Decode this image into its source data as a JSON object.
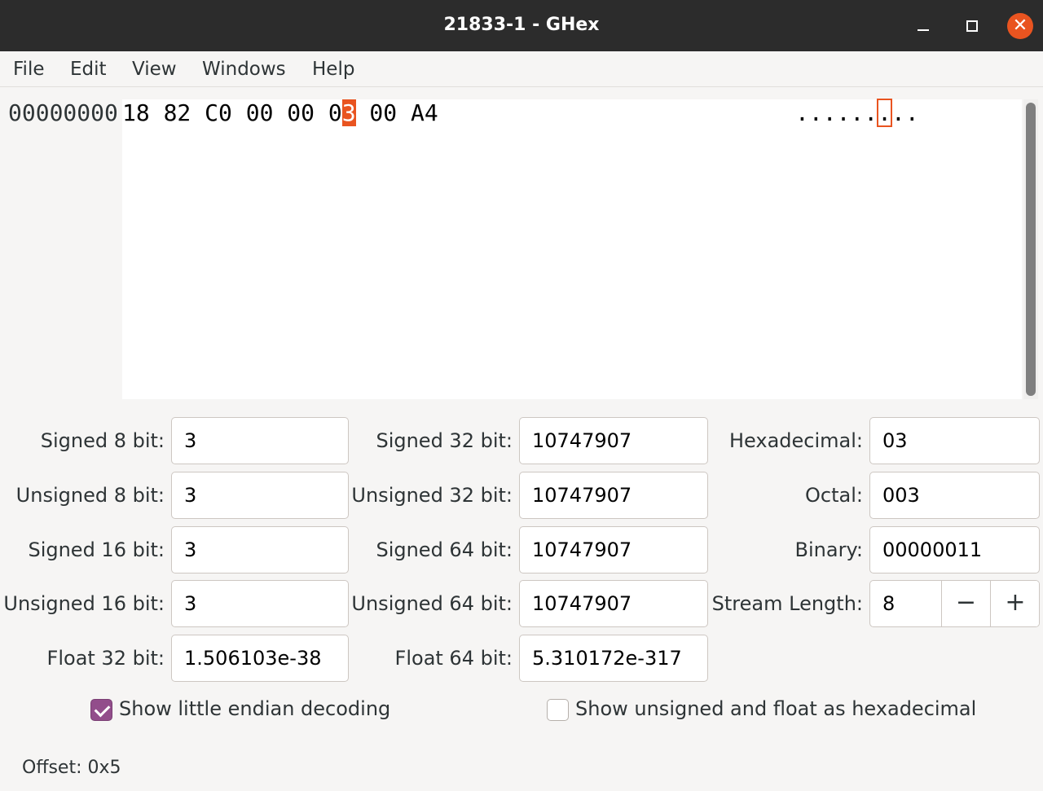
{
  "window": {
    "title": "21833-1 - GHex",
    "minimize_icon": "minimize-icon",
    "maximize_icon": "maximize-icon",
    "close_icon": "close-icon",
    "close_glyph": "✕",
    "accent": "#e95420"
  },
  "menu": {
    "items": [
      "File",
      "Edit",
      "View",
      "Windows",
      "Help"
    ]
  },
  "hex": {
    "offset": "00000000",
    "bytes_before_cursor": "18 82 C0 00 00 0",
    "cursor_nibble": "3",
    "bytes_after_cursor": " 00 A4",
    "ascii_before": "......",
    "ascii_cursor": ".",
    "ascii_after": ".."
  },
  "converter": {
    "signed8_label": "Signed 8 bit:",
    "signed8": "3",
    "unsigned8_label": "Unsigned 8 bit:",
    "unsigned8": "3",
    "signed16_label": "Signed 16 bit:",
    "signed16": "3",
    "unsigned16_label": "Unsigned 16 bit:",
    "unsigned16": "3",
    "float32_label": "Float 32 bit:",
    "float32": "1.506103e-38",
    "signed32_label": "Signed 32 bit:",
    "signed32": "10747907",
    "unsigned32_label": "Unsigned 32 bit:",
    "unsigned32": "10747907",
    "signed64_label": "Signed 64 bit:",
    "signed64": "10747907",
    "unsigned64_label": "Unsigned 64 bit:",
    "unsigned64": "10747907",
    "float64_label": "Float 64 bit:",
    "float64": "5.310172e-317",
    "hex_label": "Hexadecimal:",
    "hex": "03",
    "octal_label": "Octal:",
    "octal": "003",
    "binary_label": "Binary:",
    "binary": "00000011",
    "stream_label": "Stream Length:",
    "stream": "8",
    "stream_minus": "−",
    "stream_plus": "+"
  },
  "options": {
    "little_endian_label": "Show little endian decoding",
    "little_endian_checked": true,
    "hex_display_label": "Show unsigned and float as hexadecimal",
    "hex_display_checked": false,
    "check_color": "#924d8b"
  },
  "status": {
    "text": "Offset: 0x5"
  }
}
